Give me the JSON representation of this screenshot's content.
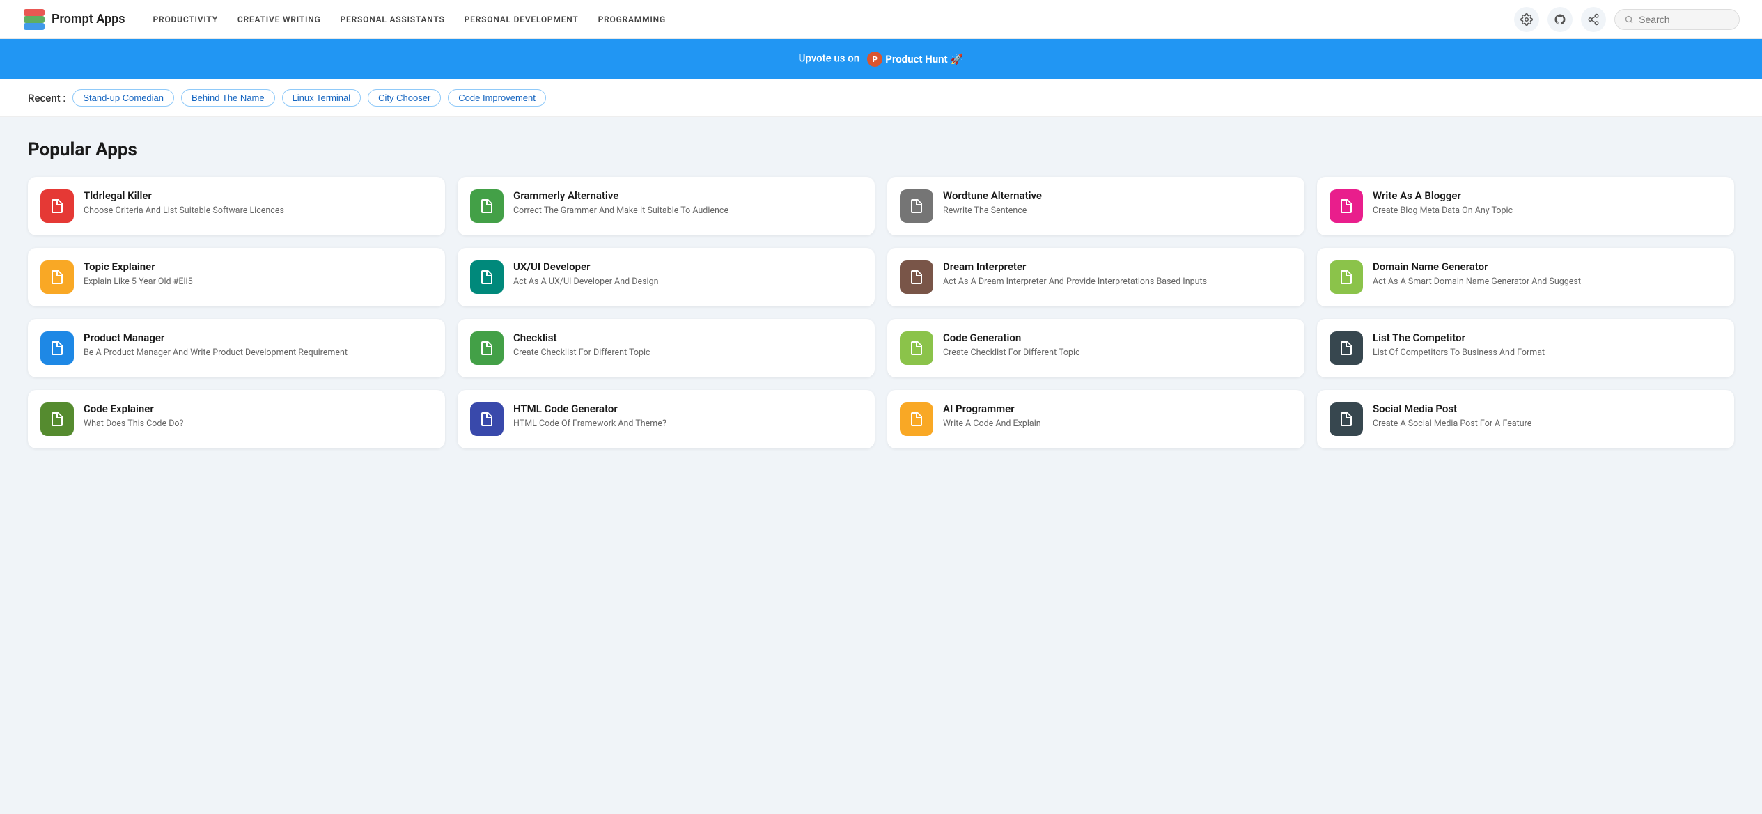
{
  "navbar": {
    "brand": "Prompt Apps",
    "links": [
      "Productivity",
      "Creative Writing",
      "Personal Assistants",
      "Personal Development",
      "Programming"
    ],
    "search_placeholder": "Search"
  },
  "banner": {
    "text": "Upvote us on",
    "platform": "Product Hunt",
    "emoji": "🚀"
  },
  "recent": {
    "label": "Recent :",
    "tags": [
      "Stand-up Comedian",
      "Behind The Name",
      "Linux Terminal",
      "City Chooser",
      "Code Improvement"
    ]
  },
  "popular": {
    "title": "Popular Apps",
    "apps": [
      {
        "name": "Tldrlegal Killer",
        "desc": "Choose Criteria And List Suitable Software Licences",
        "color": "ic-red"
      },
      {
        "name": "Grammerly Alternative",
        "desc": "Correct The Grammer And Make It Suitable To Audience",
        "color": "ic-green"
      },
      {
        "name": "Wordtune Alternative",
        "desc": "Rewrite The Sentence",
        "color": "ic-gray"
      },
      {
        "name": "Write As A Blogger",
        "desc": "Create Blog Meta Data On Any Topic",
        "color": "ic-pink"
      },
      {
        "name": "Topic Explainer",
        "desc": "Explain Like 5 Year Old #Eli5",
        "color": "ic-yellow"
      },
      {
        "name": "UX/UI Developer",
        "desc": "Act As A UX/UI Developer And Design",
        "color": "ic-teal"
      },
      {
        "name": "Dream Interpreter",
        "desc": "Act As A Dream Interpreter And Provide Interpretations Based Inputs",
        "color": "ic-brown"
      },
      {
        "name": "Domain Name Generator",
        "desc": "Act As A Smart Domain Name Generator And Suggest",
        "color": "ic-lime"
      },
      {
        "name": "Product Manager",
        "desc": "Be A Product Manager And Write Product Development Requirement",
        "color": "ic-blue"
      },
      {
        "name": "Checklist",
        "desc": "Create Checklist For Different Topic",
        "color": "ic-green"
      },
      {
        "name": "Code Generation",
        "desc": "Create Checklist For Different Topic",
        "color": "ic-lime"
      },
      {
        "name": "List The Competitor",
        "desc": "List Of Competitors To Business And Format",
        "color": "ic-dark"
      },
      {
        "name": "Code Explainer",
        "desc": "What Does This Code Do?",
        "color": "ic-olive"
      },
      {
        "name": "HTML Code Generator",
        "desc": "HTML Code Of Framework And Theme?",
        "color": "ic-indigo"
      },
      {
        "name": "AI Programmer",
        "desc": "Write A Code And Explain",
        "color": "ic-yellow"
      },
      {
        "name": "Social Media Post",
        "desc": "Create A Social Media Post For A Feature",
        "color": "ic-dark"
      }
    ]
  }
}
